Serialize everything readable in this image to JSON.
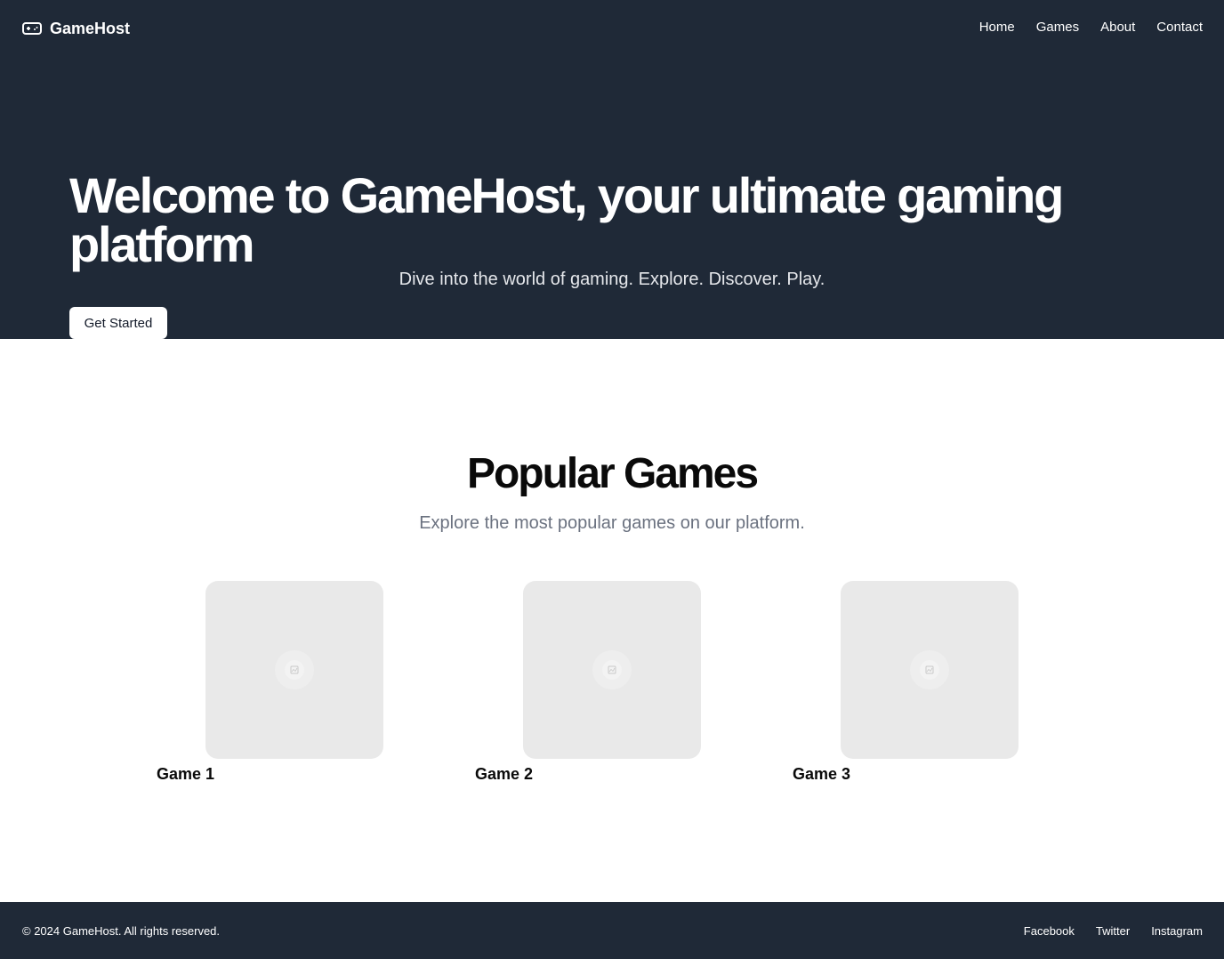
{
  "brand": {
    "name": "GameHost",
    "icon": "gamepad-icon"
  },
  "nav": {
    "items": [
      {
        "label": "Home"
      },
      {
        "label": "Games"
      },
      {
        "label": "About"
      },
      {
        "label": "Contact"
      }
    ]
  },
  "hero": {
    "title": "Welcome to GameHost, your ultimate gaming platform",
    "subtitle": "Dive into the world of gaming. Explore. Discover. Play.",
    "cta_label": "Get Started"
  },
  "popular": {
    "title": "Popular Games",
    "subtitle": "Explore the most popular games on our platform.",
    "games": [
      {
        "title": "Game 1",
        "image_icon": "image-placeholder-icon"
      },
      {
        "title": "Game 2",
        "image_icon": "image-placeholder-icon"
      },
      {
        "title": "Game 3",
        "image_icon": "image-placeholder-icon"
      }
    ]
  },
  "footer": {
    "copyright": "© 2024 GameHost. All rights reserved.",
    "links": [
      {
        "label": "Facebook"
      },
      {
        "label": "Twitter"
      },
      {
        "label": "Instagram"
      }
    ]
  },
  "colors": {
    "header_bg": "#1f2937",
    "card_bg": "#e9e9e9",
    "muted_text": "#6b7280"
  }
}
